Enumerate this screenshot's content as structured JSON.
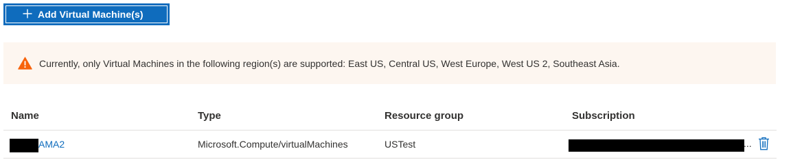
{
  "toolbar": {
    "add_button_label": "Add Virtual Machine(s)",
    "add_icon": "plus-icon"
  },
  "warning": {
    "icon": "warning-icon",
    "message": "Currently, only Virtual Machines in the following region(s) are supported: East US, Central US, West Europe, West US 2, Southeast Asia.",
    "color": "#f7630c",
    "background": "#fdf6f0"
  },
  "table": {
    "columns": [
      "Name",
      "Type",
      "Resource group",
      "Subscription"
    ],
    "rows": [
      {
        "name": "AMA2",
        "type": "Microsoft.Compute/virtualMachines",
        "resource_group": "USTest",
        "subscription_suffix": "...",
        "delete_icon": "trash-icon"
      }
    ]
  },
  "colors": {
    "accent": "#0f6cbd",
    "text": "#323130",
    "divider": "#e1dfdd"
  }
}
